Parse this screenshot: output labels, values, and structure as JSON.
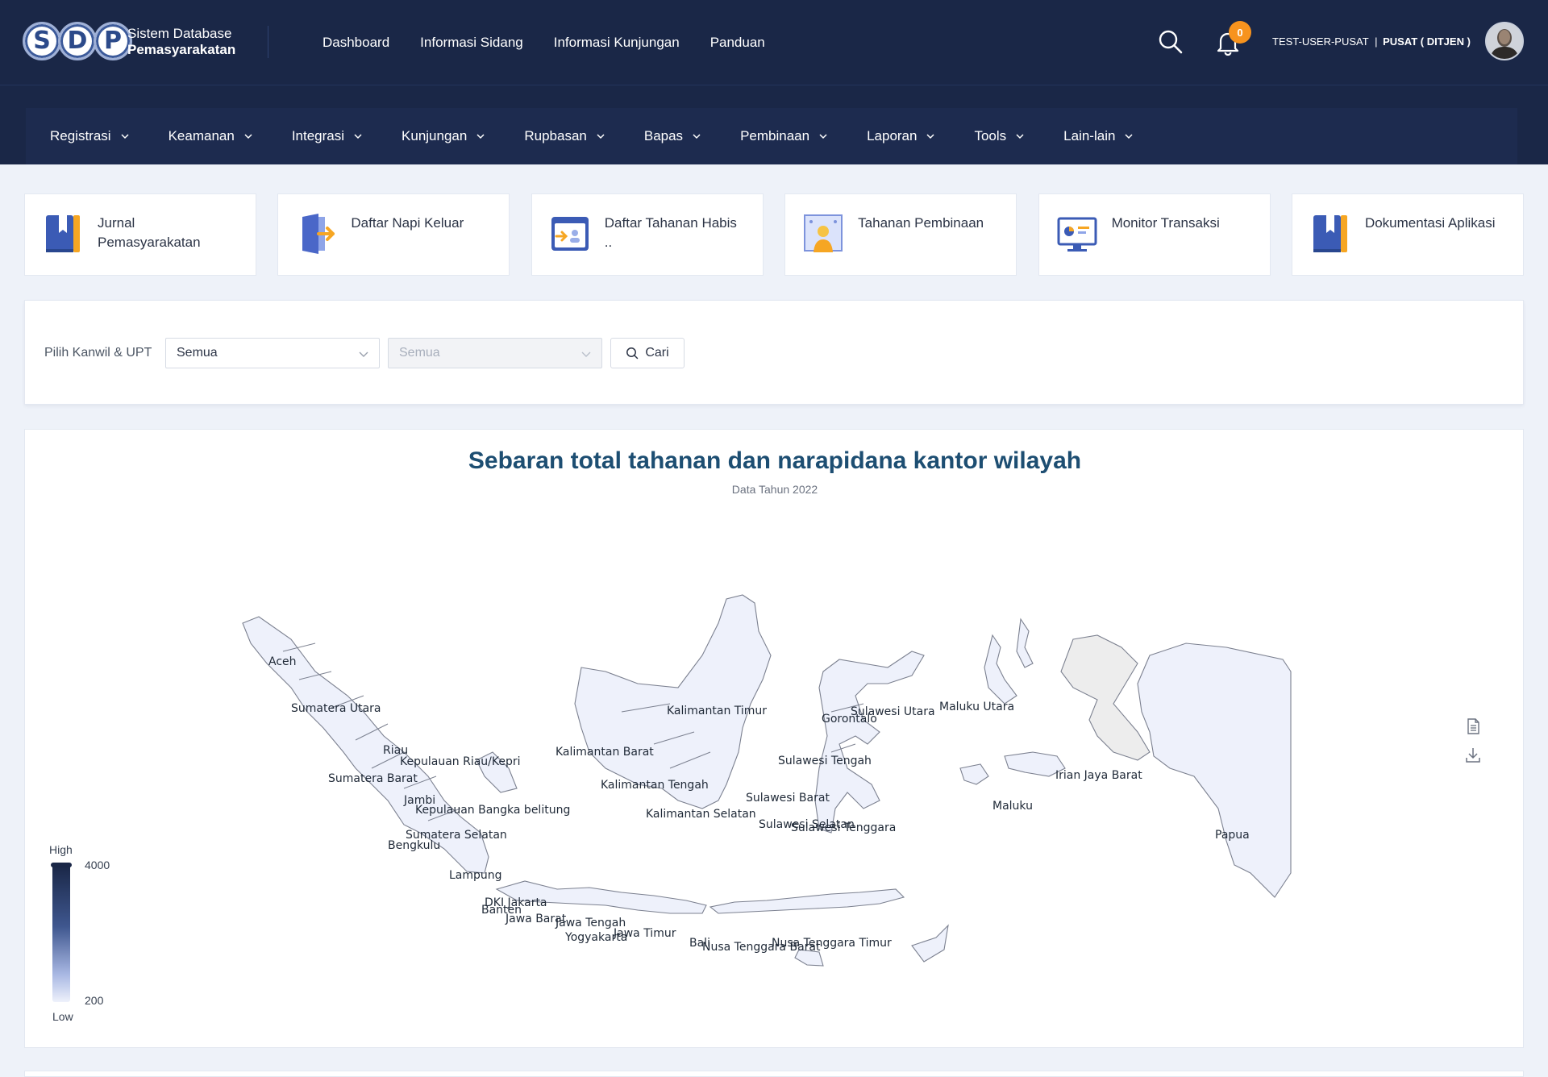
{
  "brand": {
    "logo_letters": [
      "S",
      "D",
      "P"
    ],
    "line1": "Sistem Database",
    "line2": "Pemasyarakatan"
  },
  "topnav": [
    "Dashboard",
    "Informasi Sidang",
    "Informasi Kunjungan",
    "Panduan"
  ],
  "notifications": {
    "count": "0"
  },
  "user": {
    "username": "TEST-USER-PUSAT",
    "separator": "|",
    "role": "PUSAT ( DITJEN )"
  },
  "menu": [
    "Registrasi",
    "Keamanan",
    "Integrasi",
    "Kunjungan",
    "Rupbasan",
    "Bapas",
    "Pembinaan",
    "Laporan",
    "Tools",
    "Lain-lain"
  ],
  "cards": [
    {
      "label": "Jurnal Pemasyarakatan",
      "icon": "book-icon"
    },
    {
      "label": "Daftar Napi Keluar",
      "icon": "exit-door-icon"
    },
    {
      "label": "Daftar Tahanan Habis ..",
      "icon": "detainee-list-icon"
    },
    {
      "label": "Tahanan Pembinaan",
      "icon": "person-board-icon"
    },
    {
      "label": "Monitor Transaksi",
      "icon": "monitor-chart-icon"
    },
    {
      "label": "Dokumentasi Aplikasi",
      "icon": "book-icon"
    }
  ],
  "filter": {
    "label": "Pilih Kanwil & UPT",
    "kanwil_value": "Semua",
    "upt_value": "Semua",
    "search_button": "Cari"
  },
  "map": {
    "title": "Sebaran total tahanan dan narapidana kantor wilayah",
    "subtitle": "Data Tahun 2022",
    "legend": {
      "high": "High",
      "low": "Low",
      "max": "4000",
      "min": "200"
    },
    "colors": {
      "low": "#eef1fb",
      "high": "#1a2747",
      "region_stroke": "#7c8190"
    },
    "region_labels": [
      "Aceh",
      "Sumatera Utara",
      "Riau",
      "Kepulauan Riau/Kepri",
      "Sumatera Barat",
      "Jambi",
      "Kepulauan Bangka belitung",
      "Sumatera Selatan",
      "Bengkulu",
      "Lampung",
      "DKI Jakarta",
      "Banten",
      "Jawa Barat",
      "Jawa Tengah",
      "Yogyakarta",
      "Jawa Timur",
      "Bali",
      "Nusa Tenggara Barat",
      "Nusa Tenggara Timur",
      "Kalimantan Barat",
      "Kalimantan Tengah",
      "Kalimantan Selatan",
      "Kalimantan Timur",
      "Sulawesi Utara",
      "Gorontalo",
      "Sulawesi Tengah",
      "Sulawesi Barat",
      "Sulawesi Selatan",
      "Sulawesi Tenggara",
      "Maluku Utara",
      "Maluku",
      "Irian Jaya Barat",
      "Papua"
    ]
  }
}
